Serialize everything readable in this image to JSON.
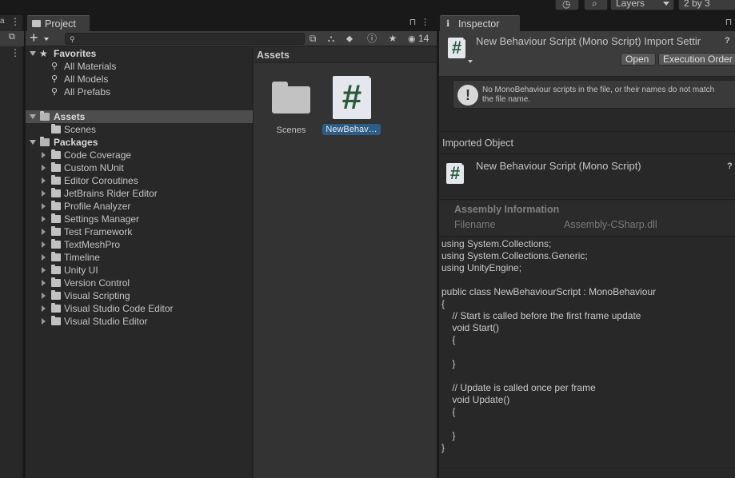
{
  "toolbar": {
    "layers_label": "Layers",
    "layout_label": "2 by 3"
  },
  "project": {
    "tab_label": "Project",
    "hidden_count": "14",
    "tree": {
      "favorites_label": "Favorites",
      "favorites": [
        "All Materials",
        "All Models",
        "All Prefabs"
      ],
      "assets_label": "Assets",
      "assets_children": [
        "Scenes"
      ],
      "packages_label": "Packages",
      "packages": [
        "Code Coverage",
        "Custom NUnit",
        "Editor Coroutines",
        "JetBrains Rider Editor",
        "Profile Analyzer",
        "Settings Manager",
        "Test Framework",
        "TextMeshPro",
        "Timeline",
        "Unity UI",
        "Version Control",
        "Visual Scripting",
        "Visual Studio Code Editor",
        "Visual Studio Editor"
      ]
    },
    "assets_header": "Assets",
    "assets": [
      {
        "label": "Scenes",
        "type": "folder"
      },
      {
        "label": "NewBehav…",
        "type": "script",
        "selected": true
      }
    ]
  },
  "inspector": {
    "tab_label": "Inspector",
    "title": "New Behaviour Script (Mono Script) Import Settir",
    "open_label": "Open",
    "execution_order_label": "Execution Order",
    "warning_text": "No MonoBehaviour scripts in the file, or their names do not match\nthe file name.",
    "imported_object_label": "Imported Object",
    "imported_title": "New Behaviour Script (Mono Script)",
    "assembly_info_label": "Assembly Information",
    "filename_key": "Filename",
    "filename_value": "Assembly-CSharp.dll",
    "code": "using System.Collections;\nusing System.Collections.Generic;\nusing UnityEngine;\n\npublic class NewBehaviourScript : MonoBehaviour\n{\n    // Start is called before the first frame update\n    void Start()\n    {\n\n    }\n\n    // Update is called once per frame\n    void Update()\n    {\n\n    }\n}"
  },
  "icons": {
    "script_symbol": "#",
    "warning_symbol": "!",
    "help_symbol": "?"
  }
}
